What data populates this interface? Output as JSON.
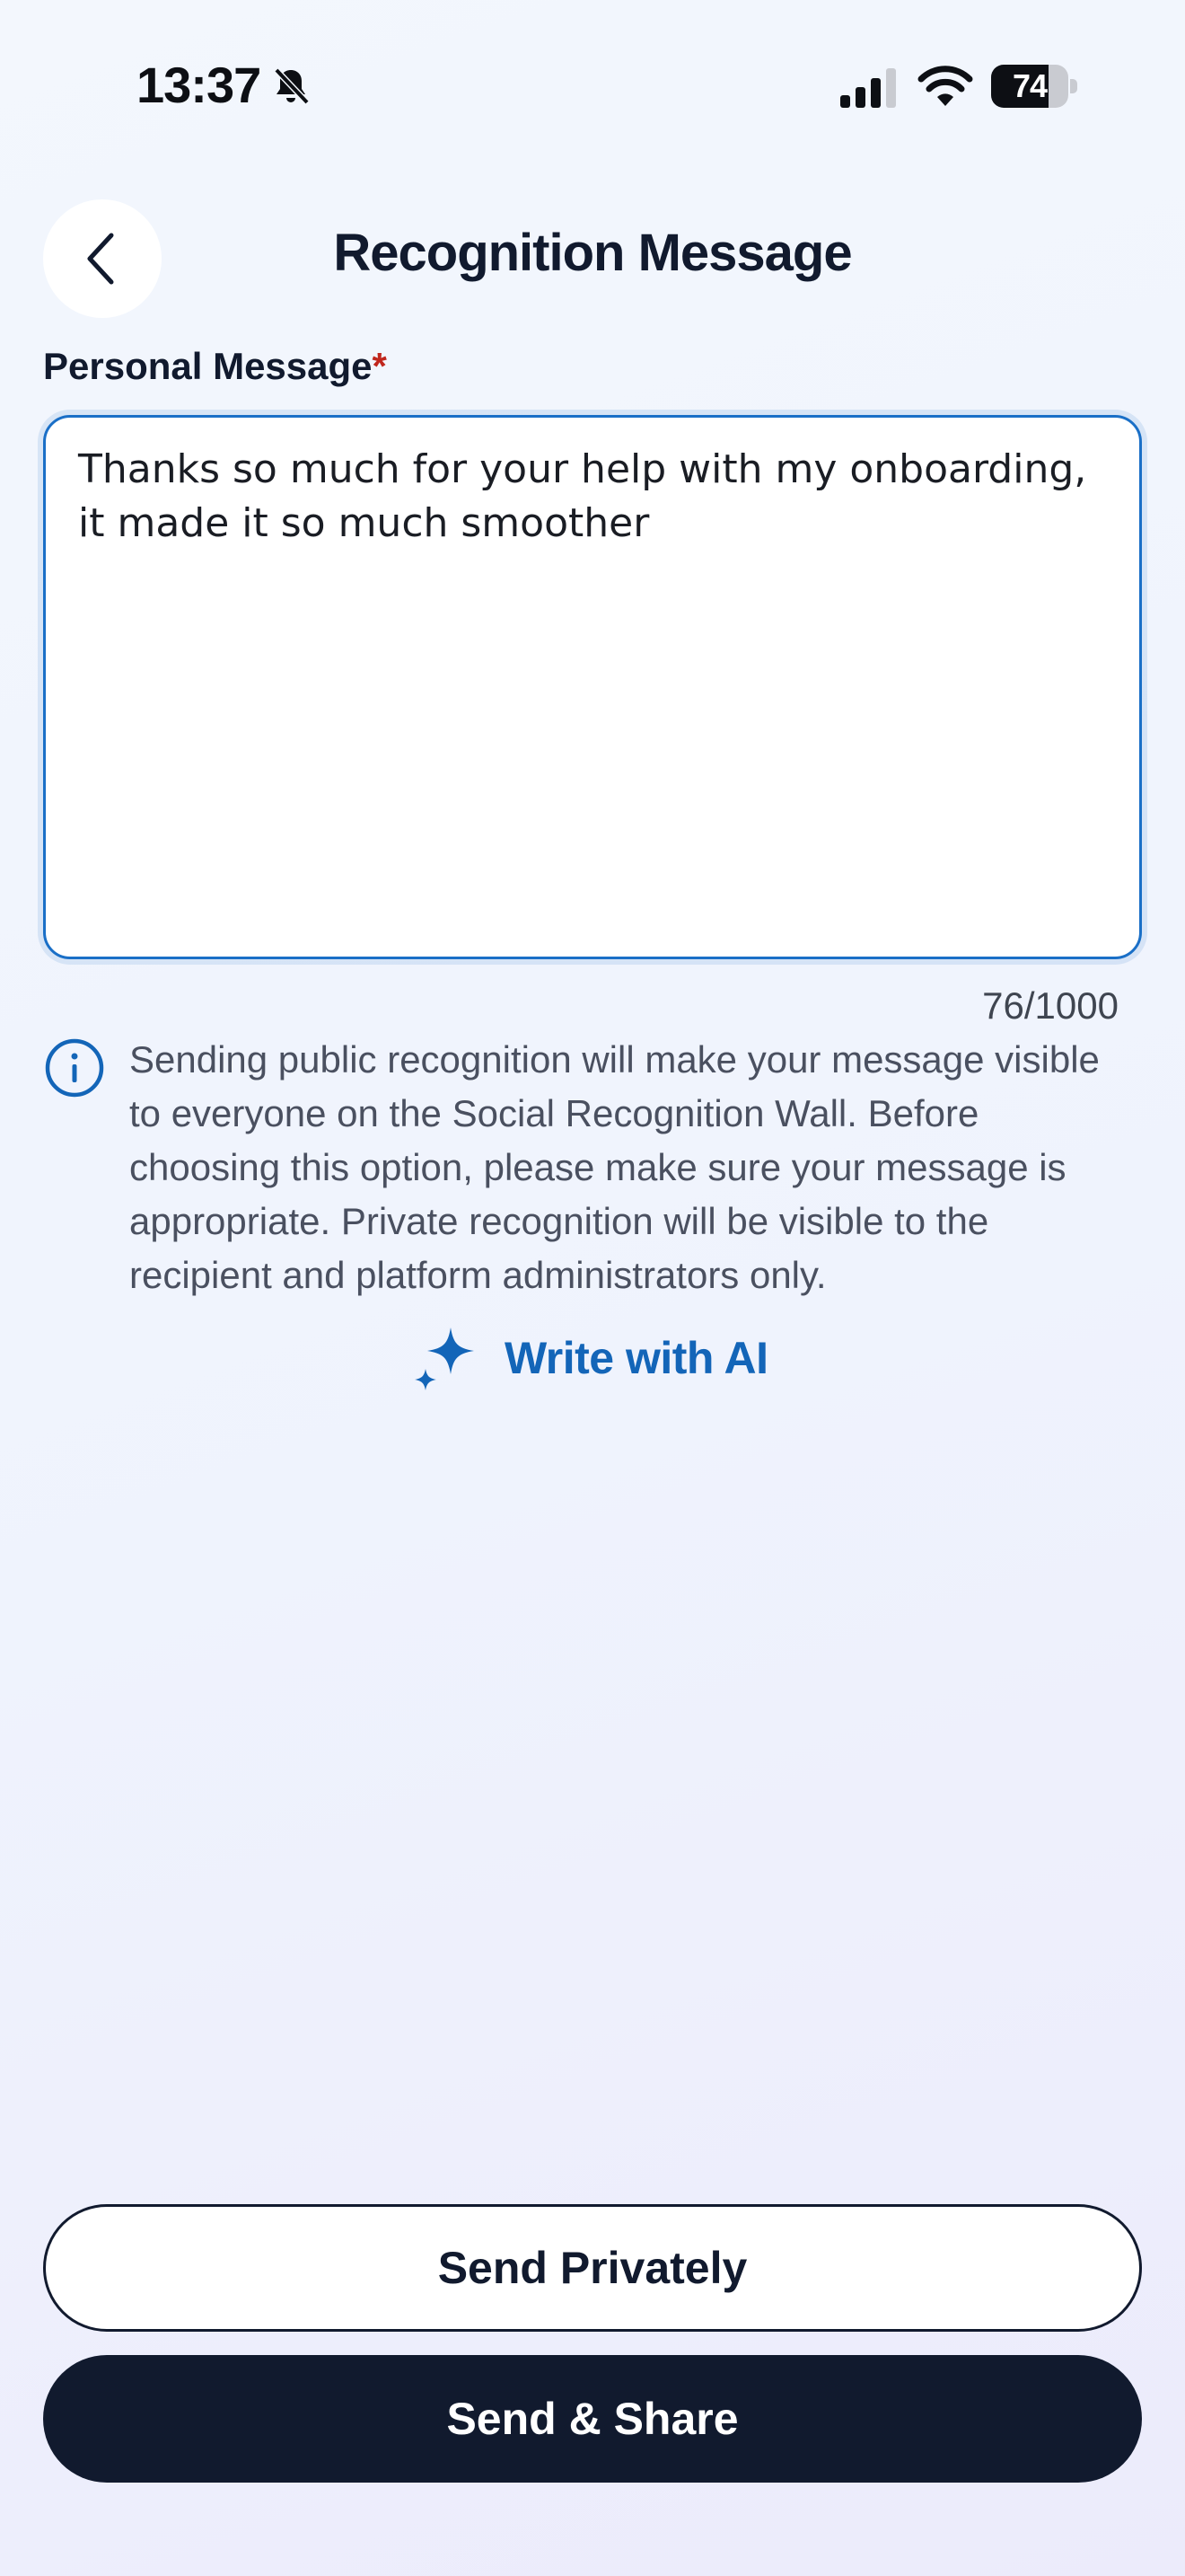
{
  "status_bar": {
    "time": "13:37",
    "battery": "74",
    "icons": [
      "bell-slash-icon",
      "cellular-signal-icon",
      "wifi-icon",
      "battery-icon"
    ]
  },
  "header": {
    "back_icon": "chevron-left-icon",
    "title": "Recognition Message"
  },
  "field": {
    "label": "Personal Message",
    "required_marker": "*",
    "value": "Thanks so much for your help with my onboarding, it made it so much smoother",
    "char_count": "76/1000"
  },
  "info": {
    "icon": "info-circle-icon",
    "text": "Sending public recognition will make your message visible to everyone on the Social Recognition Wall. Before choosing this option, please make sure your message is appropriate. Private recognition will be visible to the recipient and platform administrators only."
  },
  "ai": {
    "icon": "sparkle-icon",
    "label": "Write with AI"
  },
  "actions": {
    "send_privately": "Send Privately",
    "send_share": "Send & Share"
  },
  "colors": {
    "primary_dark": "#111a2e",
    "accent_blue": "#1365b8",
    "required_red": "#c0271d"
  }
}
